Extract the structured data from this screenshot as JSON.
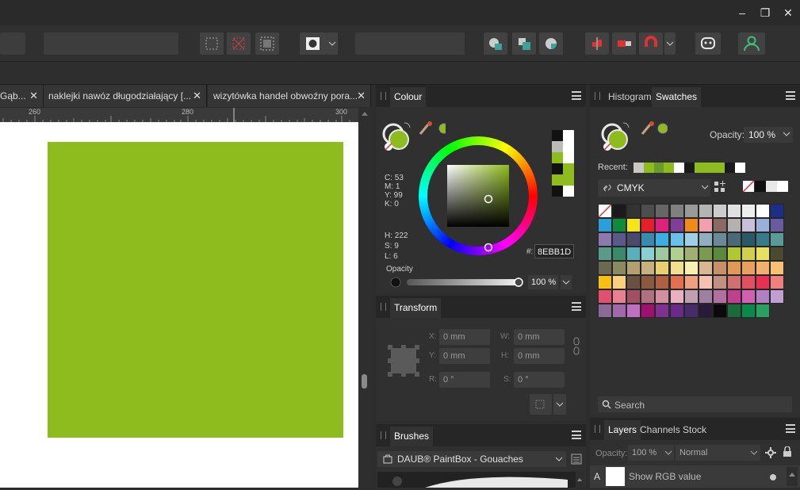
{
  "window": {
    "minimize": "–",
    "restore": "❐",
    "close": "✕"
  },
  "tabs": [
    {
      "label": "Gąb...",
      "close": "✕"
    },
    {
      "label": "naklejki nawóz długodziałający [...",
      "close": "✕"
    },
    {
      "label": "wizytówka handel obwoźny pora...",
      "close": "✕"
    }
  ],
  "ruler": {
    "ticks": [
      "260",
      "280",
      "300"
    ]
  },
  "colour_panel": {
    "title": "Colour",
    "cmyk": [
      "C: 53",
      "M: 1",
      "Y: 99",
      "K: 0"
    ],
    "hsl": [
      "H: 222",
      "S: 9",
      "L: 6"
    ],
    "hex_label": "#:",
    "hex_value": "8EBB1D",
    "opacity_label": "Opacity",
    "opacity_value": "100 %",
    "current_color": "#8EBB1D"
  },
  "transform_panel": {
    "title": "Transform",
    "x_label": "X:",
    "x_value": "0 mm",
    "y_label": "Y:",
    "y_value": "0 mm",
    "w_label": "W:",
    "w_value": "0 mm",
    "h_label": "H:",
    "h_value": "0 mm",
    "r_label": "R:",
    "r_value": "0 °",
    "s_label": "S:",
    "s_value": "0 °"
  },
  "brushes_panel": {
    "title": "Brushes",
    "category": "DAUB® PaintBox - Gouaches"
  },
  "swatches_panel": {
    "tab_histogram": "Histogram",
    "tab_swatches": "Swatches",
    "opacity_label": "Opacity:",
    "opacity_value": "100 %",
    "recent_label": "Recent:",
    "palette_name": "CMYK",
    "search_placeholder": "Search",
    "recent_colors": [
      "#c8c8c8",
      "#8EBB1D",
      "#6a9a2a",
      "#8EBB1D",
      "#ffffff",
      "#1a1a1a",
      "#8EBB1D",
      "#8EBB1D",
      "#8EBB1D",
      "#1a1a1a",
      "#ffffff"
    ],
    "palette_colors": [
      "none",
      "#1a1a1a",
      "#333333",
      "#4d4d4d",
      "#666666",
      "#808080",
      "#999999",
      "#b3b3b3",
      "#cccccc",
      "#e0e0e0",
      "#eeeeee",
      "#ffffff",
      "#1b2f86",
      "#29a0d8",
      "#0f8c3b",
      "#f5e61a",
      "#e6202a",
      "#e0207a",
      "#7f3f98",
      "#f08a1a",
      "#f2a0b0",
      "#8c6a64",
      "#b7b0b0",
      "#c8c0d8",
      "#9ab0d8",
      "#6a5aa0",
      "#8a7ab0",
      "#5a5a8a",
      "#4a4a6a",
      "#3a8ab0",
      "#3ab0e0",
      "#6ac0e8",
      "#a0d0e8",
      "#90b0c0",
      "#6a8a98",
      "#4a6a78",
      "#2a5a68",
      "#3a7a88",
      "#5a9a98",
      "#5a9a8a",
      "#3a8a6a",
      "#5ab0b8",
      "#8ad0d0",
      "#a0c8a0",
      "#b0d090",
      "#a0b070",
      "#7a9a50",
      "#5a8a40",
      "#b0c830",
      "#d0d050",
      "#e8e060",
      "#4a4a30",
      "#6a6a50",
      "#8a8a60",
      "#b0a070",
      "#c8b080",
      "#e8d070",
      "#f0e090",
      "#f8f0b0",
      "#d8b890",
      "#c89068",
      "#e09858",
      "#e8a060",
      "#f0b070",
      "#f8c070",
      "#f8c010",
      "#f8d080",
      "#6a5040",
      "#8a5a40",
      "#b06040",
      "#e07050",
      "#f0a080",
      "#f8c0b0",
      "#c09080",
      "#d07070",
      "#e05060",
      "#e83050",
      "#f08080",
      "#e05070",
      "#e88090",
      "#a05060",
      "#b07080",
      "#d090a0",
      "#e8b0c0",
      "#c0a0b0",
      "#a080a0",
      "#b070a0",
      "#c04090",
      "#d060b0",
      "#b080c0",
      "#c0a0d0",
      "#8a6a98",
      "#a06aa8",
      "#c070c0",
      "#a01070",
      "#803090",
      "#6a2a8a",
      "#4a2a6a",
      "#2a1a3a",
      "#0a0a0a",
      "#1a6a3a",
      "#0a8a4a",
      "#2aa060"
    ]
  },
  "layers_panel": {
    "tab_layers": "Layers",
    "tab_channels": "Channels",
    "tab_stock": "Stock",
    "opacity_label": "Opacity:",
    "opacity_value": "100 %",
    "blend_mode": "Normal",
    "layer_name": "Show RGB value",
    "layer_prefix": "A"
  }
}
